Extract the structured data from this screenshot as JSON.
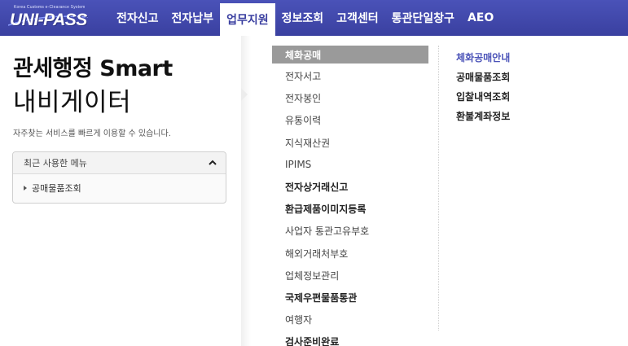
{
  "header": {
    "logo_subtext": "Korea Customs e-Clearance System",
    "logo_text": "UNI-PASS",
    "nav": [
      {
        "label": "전자신고"
      },
      {
        "label": "전자납부"
      },
      {
        "label": "업무지원"
      },
      {
        "label": "정보조회"
      },
      {
        "label": "고객센터"
      },
      {
        "label": "통관단일창구"
      },
      {
        "label": "AEO"
      }
    ],
    "active_nav_index": 2
  },
  "left": {
    "title_line1": "관세행정 Smart",
    "title_line2": "내비게이터",
    "subtitle": "자주찾는 서비스를 빠르게 이용할 수 있습니다.",
    "recent": {
      "heading": "최근 사용한 메뉴",
      "items": [
        {
          "label": "공매물품조회"
        }
      ]
    }
  },
  "menu": {
    "items": [
      {
        "label": "체화공매"
      },
      {
        "label": "전자서고"
      },
      {
        "label": "전자봉인"
      },
      {
        "label": "유통이력"
      },
      {
        "label": "지식재산권"
      },
      {
        "label": "IPIMS"
      },
      {
        "label": "전자상거래신고"
      },
      {
        "label": "환급제품이미지등록"
      },
      {
        "label": "사업자 통관고유부호"
      },
      {
        "label": "해외거래처부호"
      },
      {
        "label": "업체정보관리"
      },
      {
        "label": "국제우편물품통관"
      },
      {
        "label": "여행자"
      },
      {
        "label": "검사준비완료"
      }
    ],
    "selected_index": 0
  },
  "submenu": {
    "items": [
      {
        "label": "체화공매안내"
      },
      {
        "label": "공매물품조회"
      },
      {
        "label": "입찰내역조회"
      },
      {
        "label": "환불계좌정보"
      }
    ],
    "active_index": 0
  },
  "colors": {
    "header_bg": "#3a40a0",
    "accent": "#4a52b8",
    "selected_menu_bg": "#9a9a9a"
  }
}
